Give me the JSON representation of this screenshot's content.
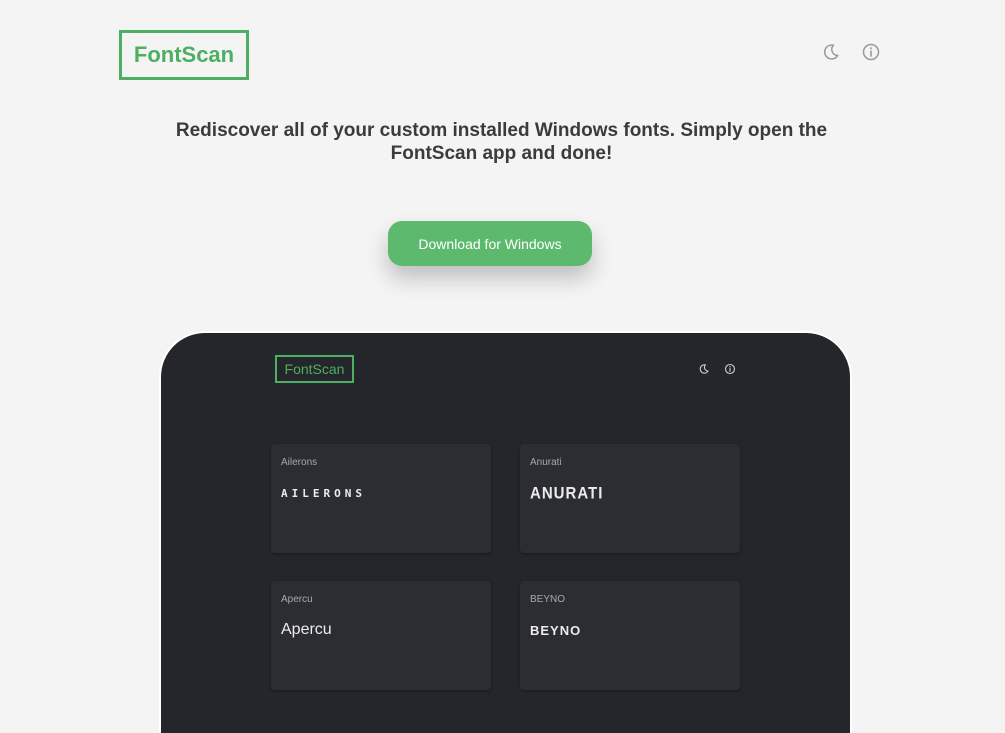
{
  "header": {
    "logo": "FontScan",
    "icons": [
      "moon-icon",
      "info-icon"
    ]
  },
  "headline": "Rediscover all of your custom installed Windows fonts. Simply open the FontScan app and done!",
  "cta": {
    "label": "Download for Windows"
  },
  "preview": {
    "logo": "FontScan",
    "cards": [
      {
        "name": "Ailerons",
        "sample": "AILERONS"
      },
      {
        "name": "Anurati",
        "sample": "ANURATI"
      },
      {
        "name": "Apercu",
        "sample": "Apercu"
      },
      {
        "name": "BEYNO",
        "sample": "BEYNO"
      }
    ]
  },
  "colors": {
    "background": "#f4f4f4",
    "accent": "#4caf62",
    "button": "#5cb96d",
    "preview_bg": "#24262b",
    "card_bg": "#2c2d32",
    "headline_text": "#3b3b3b"
  }
}
